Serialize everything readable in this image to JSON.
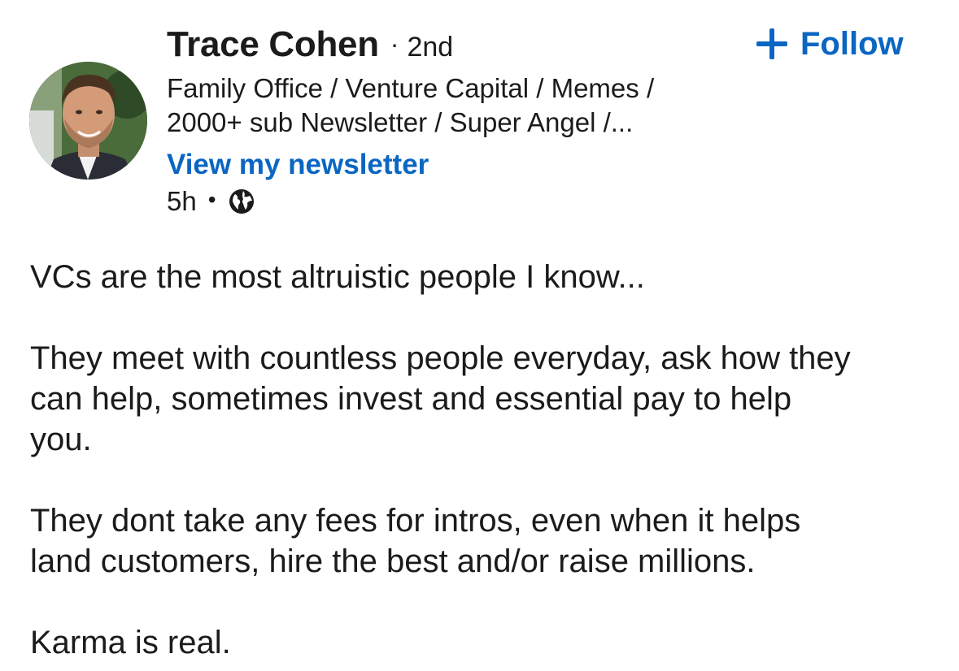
{
  "author": {
    "name": "Trace Cohen",
    "degree_separator": "·",
    "degree": "2nd",
    "headline_lines": [
      "Family Office / Venture Capital / Memes /",
      "2000+ sub Newsletter / Super Angel /..."
    ],
    "newsletter_link": "View my newsletter",
    "avatar_icon": "profile-photo"
  },
  "follow": {
    "icon": "plus-icon",
    "label": "Follow",
    "color": "#0a66c2"
  },
  "meta": {
    "time": "5h",
    "separator": "•",
    "visibility_icon": "globe-icon"
  },
  "post": {
    "paragraphs": [
      [
        "VCs are the most altruistic people I know..."
      ],
      [
        "They meet with countless people everyday, ask how they",
        "can help, sometimes invest and essential pay to help",
        "you."
      ],
      [
        "They dont take any fees for intros, even when it helps",
        "land customers, hire the best and/or raise millions."
      ],
      [
        "Karma is real."
      ]
    ]
  },
  "colors": {
    "text": "#1b1b1b",
    "link": "#0a66c2",
    "background": "#ffffff"
  }
}
